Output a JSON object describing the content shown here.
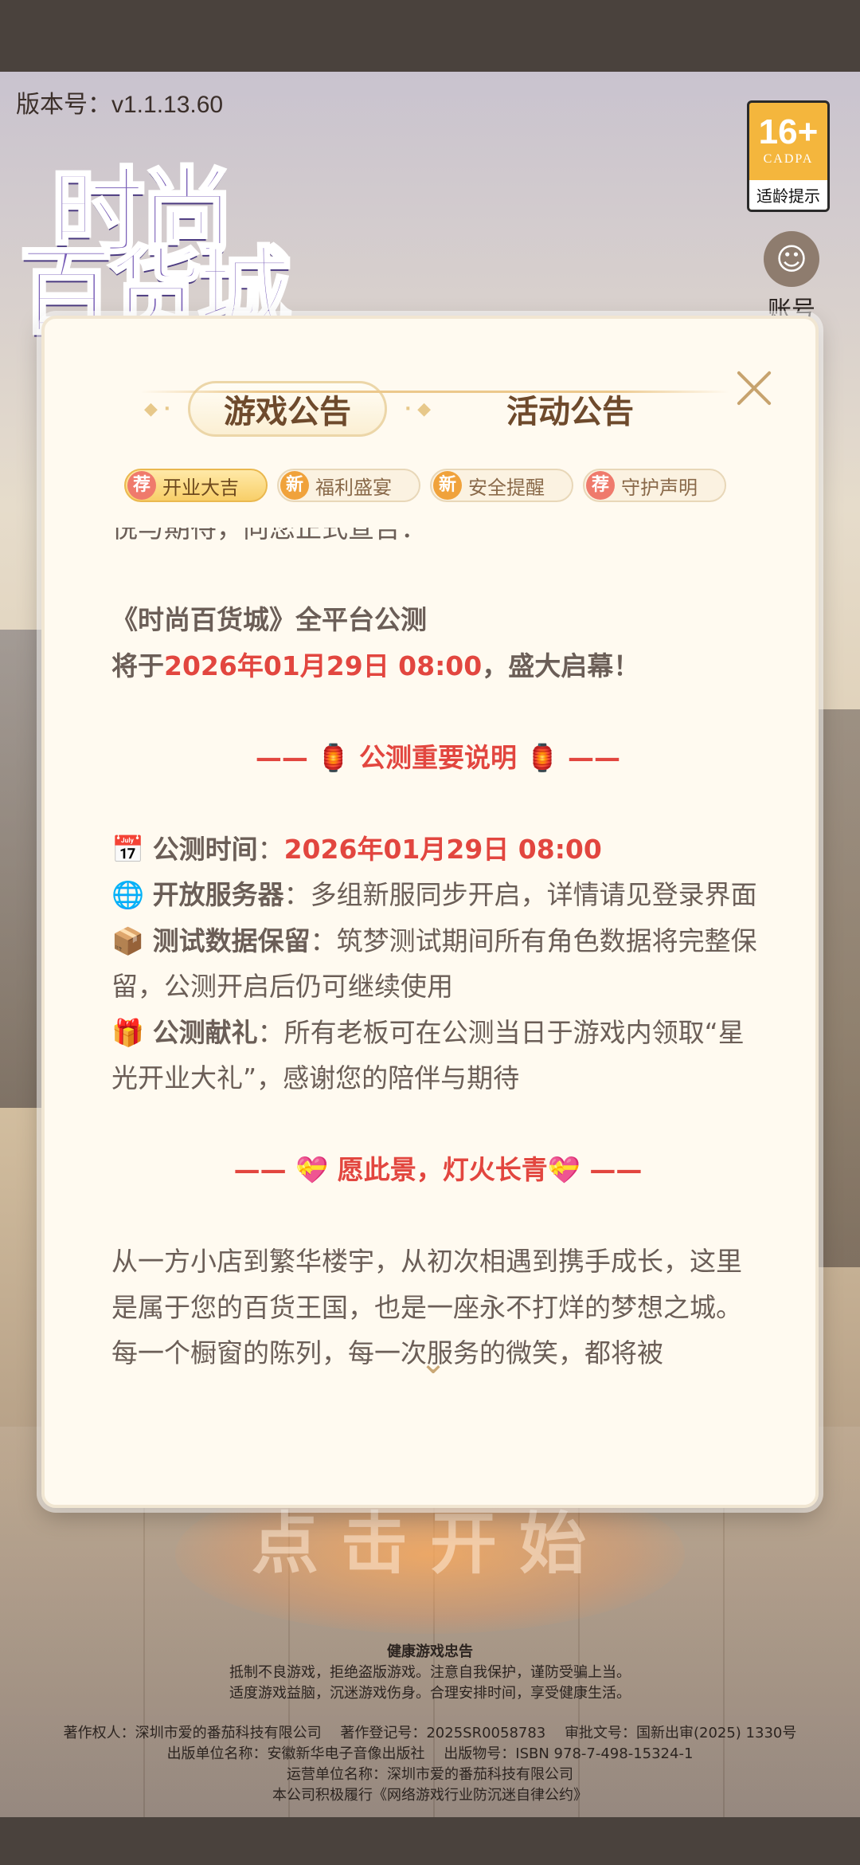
{
  "version": "版本号：v1.1.13.60",
  "logo": {
    "line1": "时尚",
    "line2": "百货城"
  },
  "age_badge": {
    "rating": "16+",
    "org": "CADPA",
    "tip": "适龄提示"
  },
  "account": {
    "label": "账号"
  },
  "start_text": "点击开始",
  "modal": {
    "tabs": [
      {
        "label": "游戏公告",
        "active": true
      },
      {
        "label": "活动公告",
        "active": false
      }
    ],
    "subtabs": [
      {
        "badge": "荐",
        "label": "开业大吉",
        "active": true
      },
      {
        "badge": "新",
        "label": "福利盛宴",
        "active": false
      },
      {
        "badge": "新",
        "label": "安全提醒",
        "active": false
      },
      {
        "badge": "荐",
        "label": "守护声明",
        "active": false
      }
    ],
    "content": {
      "cut_top": "悦与期待，向您正式宣告：",
      "announce_title": "《时尚百货城》全平台公测",
      "announce_prefix": "将于",
      "announce_date": "2026年01月29日 08:00",
      "announce_suffix": "，盛大启幕！",
      "section1_heading": "—— 🏮 公测重要说明 🏮 ——",
      "items": [
        {
          "icon": "📅",
          "label": "公测时间",
          "sep": "：",
          "value": "2026年01月29日 08:00"
        },
        {
          "icon": "🌐",
          "label": "开放服务器",
          "sep": "：",
          "value": "多组新服同步开启，详情请见登录界面"
        },
        {
          "icon": "📦",
          "label": "测试数据保留",
          "sep": "：",
          "value": "筑梦测试期间所有角色数据将完整保留，公测开启后仍可继续使用"
        },
        {
          "icon": "🎁",
          "label": "公测献礼",
          "sep": "：",
          "value": "所有老板可在公测当日于游戏内领取“星光开业大礼”，感谢您的陪伴与期待"
        }
      ],
      "section2_heading": "—— 💝 愿此景，灯火长青💝 ——",
      "closing": "从一方小店到繁华楼宇，从初次相遇到携手成长，这里是属于您的百货王国，也是一座永不打烊的梦想之城。每一个橱窗的陈列，每一次服务的微笑，都将被"
    }
  },
  "health": {
    "title": "健康游戏忠告",
    "line1": "抵制不良游戏，拒绝盗版游戏。注意自我保护，谨防受骗上当。",
    "line2": "适度游戏益脑，沉迷游戏伤身。合理安排时间，享受健康生活。"
  },
  "credits": {
    "line1": "著作权人：深圳市爱的番茄科技有限公司　 著作登记号：2025SR0058783　 审批文号：国新出审(2025) 1330号",
    "line2": "出版单位名称：安徽新华电子音像出版社　 出版物号：ISBN 978-7-498-15324-1",
    "line3": "运营单位名称：深圳市爱的番茄科技有限公司",
    "line4": "本公司积极履行《网络游戏行业防沉迷自律公约》"
  },
  "colors": {
    "accent_red": "#e2463f",
    "tab_text": "#6e4a2c",
    "modal_bg": "#fffaf0"
  }
}
